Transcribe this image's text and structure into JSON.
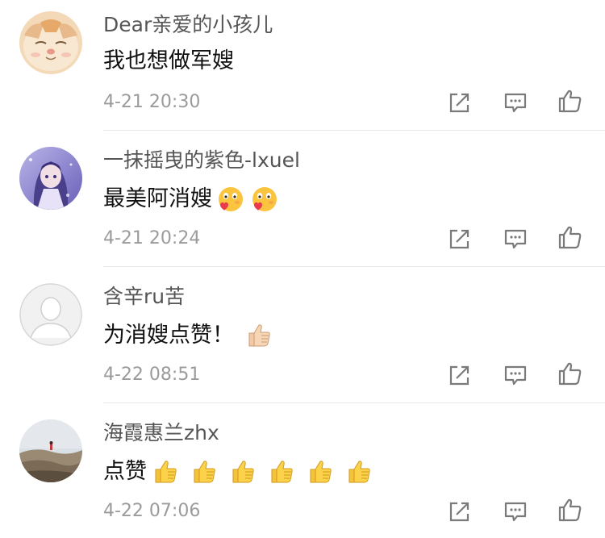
{
  "comments": [
    {
      "username": "Dear亲爱的小孩儿",
      "text": "我也想做军嫂",
      "timestamp": "4-21 20:30",
      "avatar": "cat-avatar",
      "emojis": []
    },
    {
      "username": "一抹摇曳的紫色-lxuel",
      "text": "最美阿消嫂",
      "timestamp": "4-21 20:24",
      "avatar": "anime-girl-avatar",
      "emojis": [
        "heart-face-emoji",
        "heart-face-emoji"
      ]
    },
    {
      "username": "含辛ru苦",
      "text": "为消嫂点赞！",
      "timestamp": "4-22 08:51",
      "avatar": "default-avatar",
      "emojis": [
        "thumbs-up-emoji"
      ]
    },
    {
      "username": "海霞惠兰zhx",
      "text": "点赞",
      "timestamp": "4-22 07:06",
      "avatar": "landscape-avatar",
      "emojis": [
        "thumbs-up-emoji",
        "thumbs-up-emoji",
        "thumbs-up-emoji",
        "thumbs-up-emoji",
        "thumbs-up-emoji",
        "thumbs-up-emoji"
      ]
    }
  ],
  "actions": [
    "share-icon",
    "reply-icon",
    "like-icon"
  ],
  "colors": {
    "username": "#555555",
    "text": "#111111",
    "timestamp": "#9b9b9b",
    "icon": "#7a7a7a",
    "divider": "#e6e6e6"
  }
}
